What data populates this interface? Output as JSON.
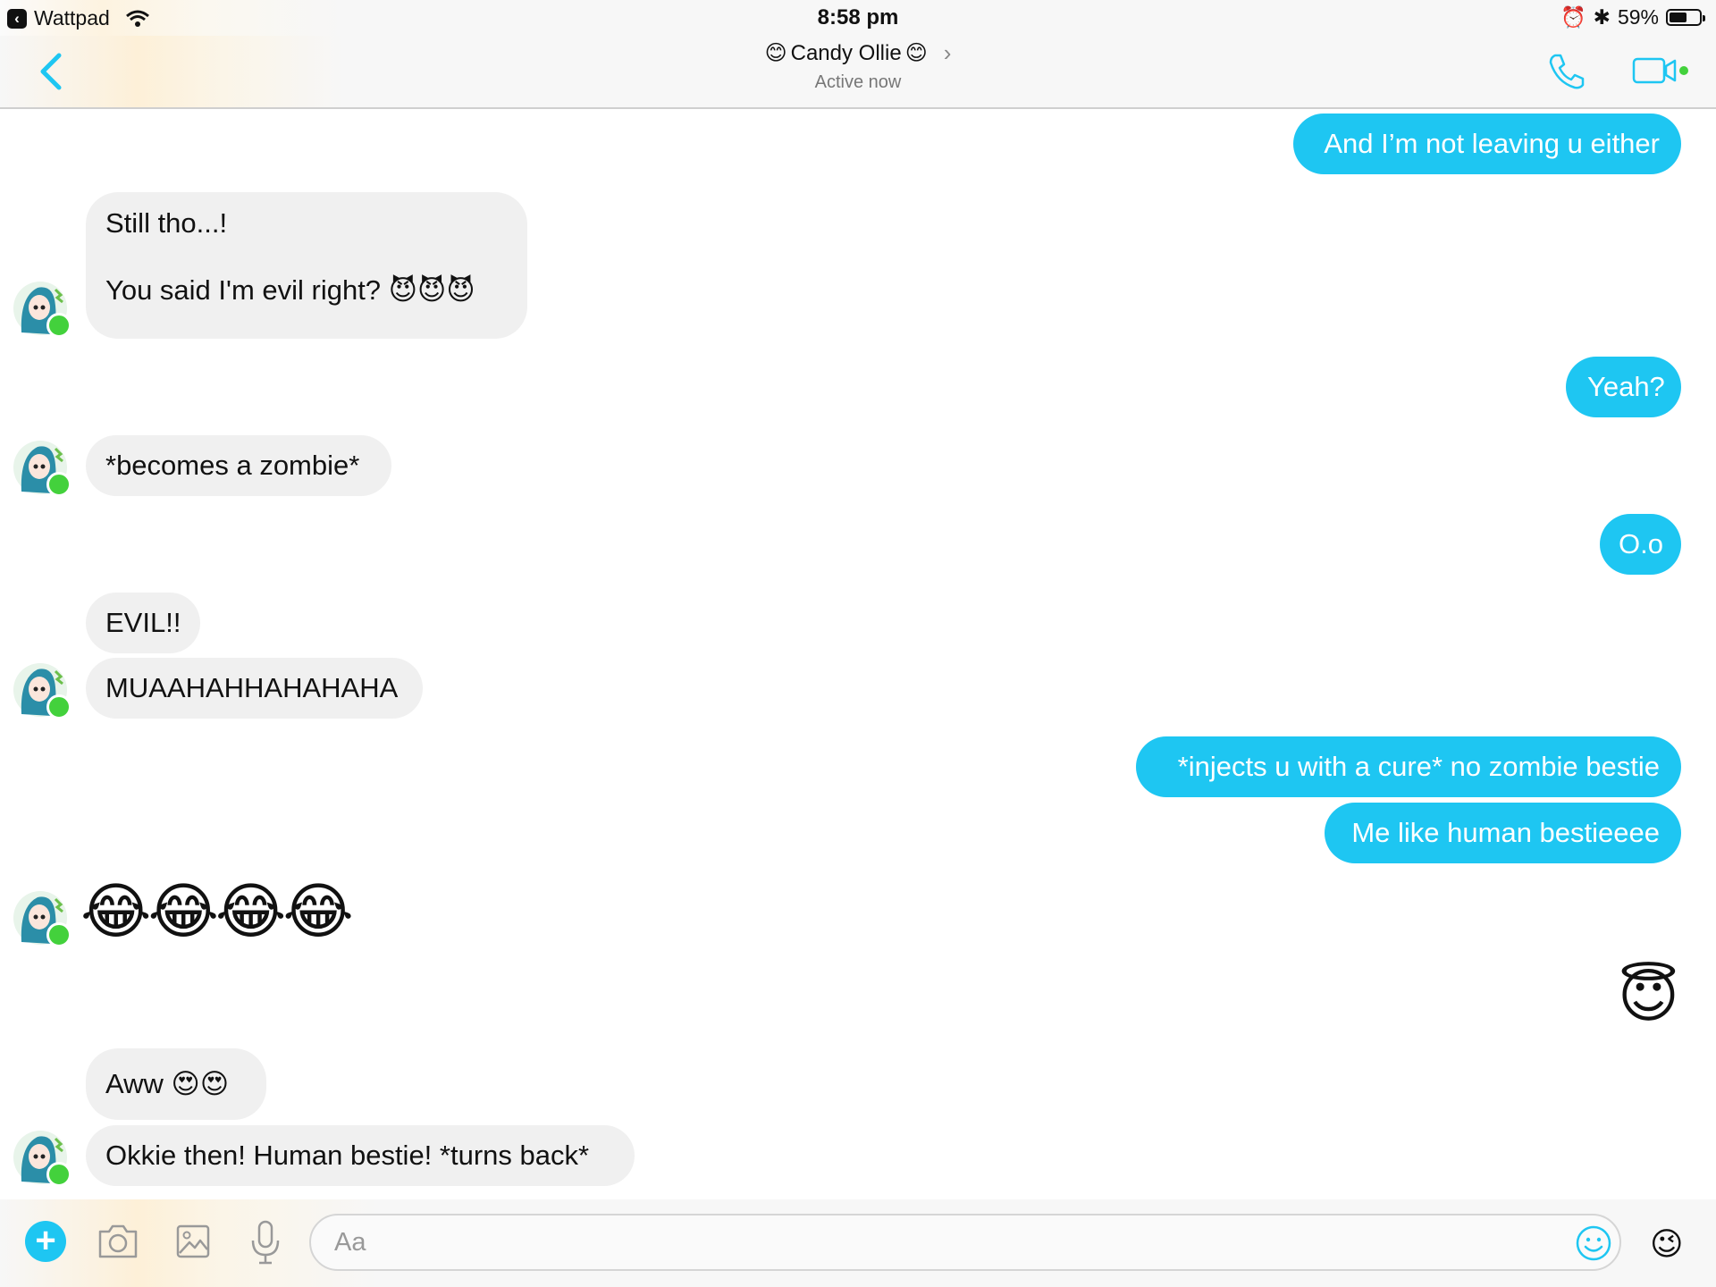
{
  "status_bar": {
    "back_app": "Wattpad",
    "time": "8:58 pm",
    "battery": "59%",
    "battery_level": 0.59
  },
  "header": {
    "title": "Candy Ollie",
    "title_emoji": "😊",
    "subtitle": "Active now",
    "icons": [
      "back-arrow-icon",
      "phone-icon",
      "video-camera-icon"
    ]
  },
  "messages": {
    "m1": "And I’m not leaving u either",
    "m2a": "Still tho...!",
    "m2b": "You said I'm evil right?",
    "m2b_emoji": "😈😈😈",
    "m3": "Yeah?",
    "m4": "*becomes a zombie*",
    "m5": "O.o",
    "m6": "EVIL!!",
    "m7": "MUAAHAHHAHAHAHA",
    "m8": "*injects u with a cure* no zombie bestie",
    "m9": "Me like human bestieeee",
    "m10": "😂😂😂😂",
    "m11": "😇",
    "m12": "Aww",
    "m12_emoji": "😍😍",
    "m13": "Okkie then! Human bestie! *turns back*"
  },
  "composer": {
    "placeholder": "Aa",
    "plus_label": "+",
    "like_emoji": "😉",
    "icons": [
      "plus-icon",
      "camera-icon",
      "image-icon",
      "microphone-icon",
      "emoji-icon"
    ]
  },
  "colors": {
    "accent": "#1ec6f2",
    "incoming_bubble": "#f0f0f0",
    "online": "#43d13c"
  }
}
